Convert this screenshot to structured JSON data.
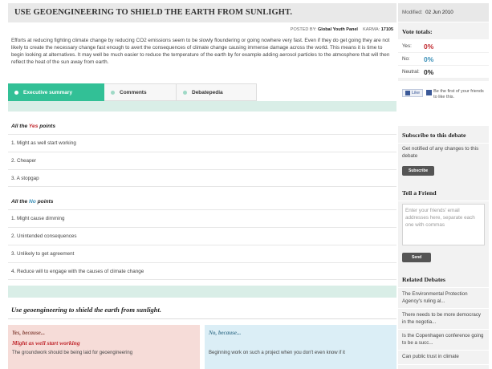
{
  "header": {
    "title": "USE GEOENGINEERING TO SHIELD THE EARTH FROM SUNLIGHT.",
    "posted_by_label": "POSTED BY:",
    "posted_by": "Global Youth Panel",
    "karma_label": "KARMA:",
    "karma": "17105"
  },
  "intro": "Efforts at reducing fighting climate change by reducing CO2 emissions seem to be slowly floundering or going nowhere very fast. Even if they do get going they are not likely to create the necessary change fast enough to avert the consequences of climate change causing immense damage across the world. This means it is time to begin looking at alternatives. It may well be much easier to reduce the temperature of the earth by for example adding aerosol particles to the atmosphere that will then reflect the heat of the sun away from earth.",
  "tabs": [
    {
      "label": "Executive summary"
    },
    {
      "label": "Comments"
    },
    {
      "label": "Debatepedia"
    }
  ],
  "yes_section": {
    "prefix": "All the",
    "word": "Yes",
    "suffix": "points",
    "points": [
      "1. Might as well start working",
      "2. Cheaper",
      "3. A stopgap"
    ]
  },
  "no_section": {
    "prefix": "All the",
    "word": "No",
    "suffix": "points",
    "points": [
      "1. Might cause dimming",
      "2. Unintended consequences",
      "3. Unlikely to get agreement",
      "4. Reduce will to engage with the causes of climate change"
    ]
  },
  "debate": {
    "title": "Use geoengineering to shield the earth from sunlight.",
    "yes_head": "Yes, because...",
    "yes_sub": "Might as well start working",
    "yes_text": "The groundwork should be being laid for geoengineering",
    "no_head": "No, because...",
    "no_text": "Beginning work on such a project when you don't even know if it"
  },
  "sidebar": {
    "modified_label": "Modified:",
    "modified_date": "02 Jun 2010",
    "vote_title": "Vote totals:",
    "votes": [
      {
        "label": "Yes:",
        "value": "0%",
        "color": "#c0272d"
      },
      {
        "label": "No:",
        "value": "0%",
        "color": "#3a8fb7"
      },
      {
        "label": "Neutral:",
        "value": "0%",
        "color": "#222222"
      }
    ],
    "like_label": "Like",
    "like_text": "Be the first of your friends to like this.",
    "subscribe_title": "Subscribe to this debate",
    "subscribe_text": "Get notified of any changes to this debate",
    "subscribe_button": "Subscribe",
    "tell_title": "Tell a Friend",
    "tell_placeholder": "Enter your friends' email addresses here, separate each one with commas",
    "send_button": "Send",
    "related_title": "Related Debates",
    "related": [
      "The Environmental Protection Agency's ruling al...",
      "There needs to be more democracy in the negotia...",
      "Is the Copenhagen conference going to be a succ...",
      "Can public trust in climate"
    ]
  }
}
